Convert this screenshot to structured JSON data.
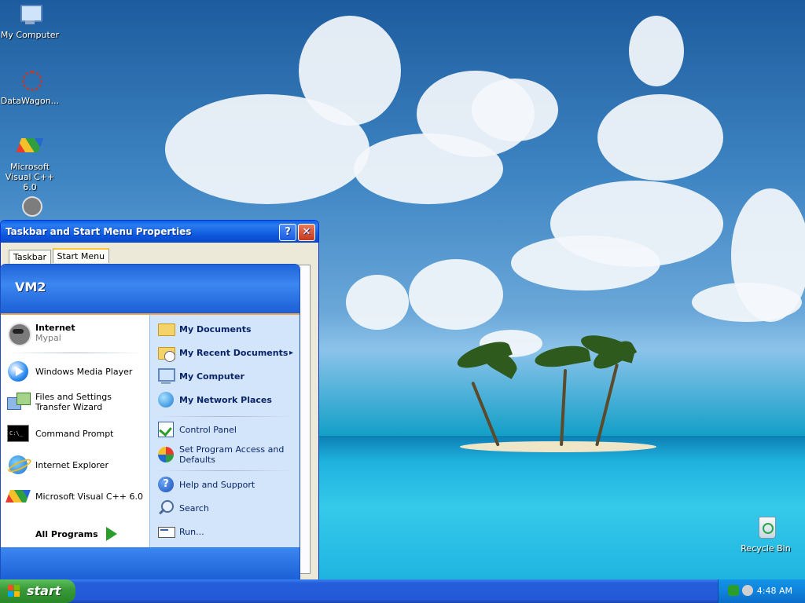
{
  "desktop": {
    "icons": [
      {
        "label": "My Computer"
      },
      {
        "label": "DataWagon..."
      },
      {
        "label": "Microsoft Visual C++ 6.0"
      },
      {
        "label": "Recycle Bin"
      }
    ]
  },
  "properties_window": {
    "title": "Taskbar and Start Menu Properties",
    "help_glyph": "?",
    "close_glyph": "✕",
    "tabs": [
      "Taskbar",
      "Start Menu"
    ]
  },
  "start_menu": {
    "user_name": "VM2",
    "left_items": [
      {
        "label": "Internet",
        "sub": "Mypal"
      },
      {
        "label": "Windows Media Player"
      },
      {
        "label": "Files and Settings Transfer Wizard"
      },
      {
        "label": "Command Prompt"
      },
      {
        "label": "Internet Explorer"
      },
      {
        "label": "Microsoft Visual C++ 6.0"
      }
    ],
    "all_programs": "All Programs",
    "right_items": [
      {
        "label": "My Documents"
      },
      {
        "label": "My Recent Documents"
      },
      {
        "label": "My Computer"
      },
      {
        "label": "My Network Places"
      },
      {
        "label": "Control Panel"
      },
      {
        "label": "Set Program Access and Defaults"
      },
      {
        "label": "Help and Support"
      },
      {
        "label": "Search"
      },
      {
        "label": "Run..."
      }
    ],
    "submenu_arrow": "▸"
  },
  "taskbar": {
    "start_label": "start",
    "clock": "4:48 AM"
  }
}
